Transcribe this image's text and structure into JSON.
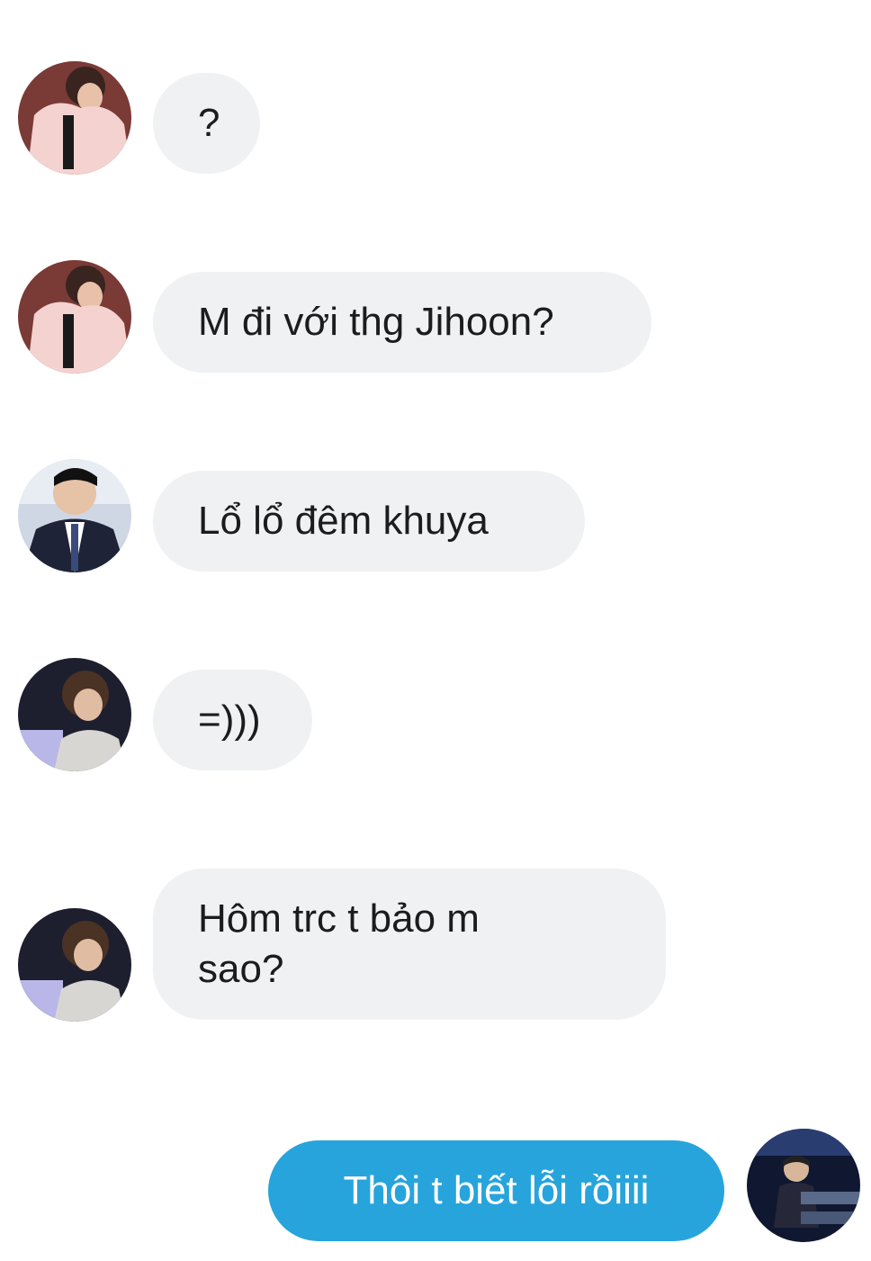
{
  "messages": [
    {
      "direction": "incoming",
      "avatar": "avatar-pink-jacket",
      "text": "?"
    },
    {
      "direction": "incoming",
      "avatar": "avatar-pink-jacket",
      "text": "M đi với thg Jihoon?"
    },
    {
      "direction": "incoming",
      "avatar": "avatar-suit",
      "text": "Lổ lổ đêm khuya"
    },
    {
      "direction": "incoming",
      "avatar": "avatar-stage",
      "text": "=)))"
    },
    {
      "direction": "incoming",
      "avatar": "avatar-stage",
      "text": "Hôm trc t bảo m\nsao?"
    },
    {
      "direction": "outgoing",
      "avatar": "avatar-keyboard",
      "text": "Thôi t biết lỗi rồiiii"
    }
  ],
  "colors": {
    "incoming_bubble": "#f0f1f3",
    "outgoing_bubble": "#27a4dc",
    "text": "#1c1c1e"
  }
}
